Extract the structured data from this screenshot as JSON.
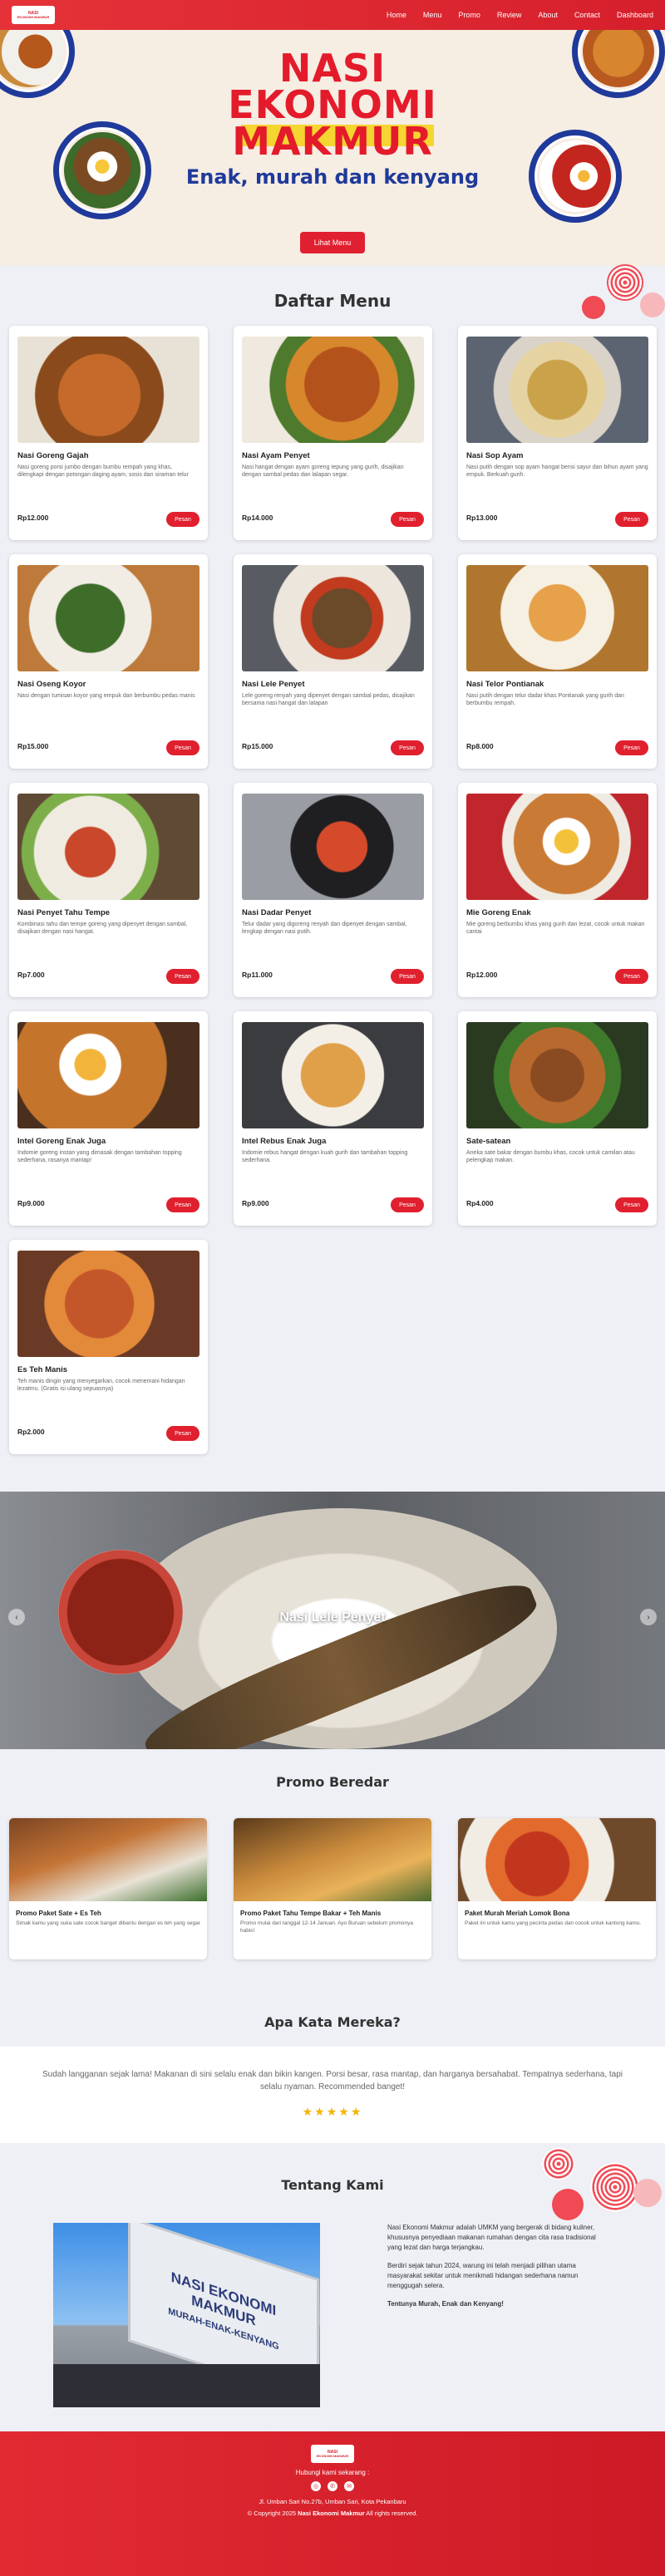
{
  "brand": {
    "logo_line1": "NASI",
    "logo_line2": "EKONOMI MAKMUR"
  },
  "nav": {
    "items": [
      "Home",
      "Menu",
      "Promo",
      "Review",
      "About",
      "Contact",
      "Dashboard"
    ]
  },
  "hero": {
    "title1": "NASI",
    "title2": "EKONOMI",
    "title3": "MAKMUR",
    "subtitle": "Enak, murah dan kenyang",
    "button": "Lihat Menu"
  },
  "menu_section": {
    "title": "Daftar Menu",
    "order_label": "Pesan"
  },
  "menu": [
    {
      "name": "Nasi Goreng Gajah",
      "desc": "Nasi goreng porsi jumbo dengan bumbu rempah yang khas, dilengkapi dengan potongan daging ayam, sosis dan siraman telur",
      "price": "Rp12.000"
    },
    {
      "name": "Nasi Ayam Penyet",
      "desc": "Nasi hangat dengan ayam goreng tepung yang gurih, disajikan dengan sambal pedas dan lalapan segar.",
      "price": "Rp14.000"
    },
    {
      "name": "Nasi Sop Ayam",
      "desc": "Nasi putih dengan sop ayam hangat berisi sayur dan bihun ayam yang empuk. Berkuah gurih.",
      "price": "Rp13.000"
    },
    {
      "name": "Nasi Oseng Koyor",
      "desc": "Nasi dengan tumisan koyor yang empuk dan berbumbu pedas manis",
      "price": "Rp15.000"
    },
    {
      "name": "Nasi Lele Penyet",
      "desc": "Lele goreng renyah yang dipenyet dengan sambal pedas, disajikan bersama nasi hangat dan lalapan",
      "price": "Rp15.000"
    },
    {
      "name": "Nasi Telor Pontianak",
      "desc": "Nasi putih dengan telur dadar khas Pontianak yang gurih dan berbumbu rempah.",
      "price": "Rp8.000"
    },
    {
      "name": "Nasi Penyet Tahu Tempe",
      "desc": "Kombinasi tahu dan tempe goreng yang dipenyet dengan sambal, disajikan dengan nasi hangat.",
      "price": "Rp7.000"
    },
    {
      "name": "Nasi Dadar Penyet",
      "desc": "Telur dadar yang digoreng renyah dan dipenyet dengan sambal, lengkap dengan nasi putih.",
      "price": "Rp11.000"
    },
    {
      "name": "Mie Goreng Enak",
      "desc": "Mie goreng berbumbu khas yang gurih dan lezat, cocok untuk makan cantai",
      "price": "Rp12.000"
    },
    {
      "name": "Intel Goreng Enak Juga",
      "desc": "Indomie goreng instan yang dimasak dengan tambahan topping sederhana, rasanya mantap!",
      "price": "Rp9.000"
    },
    {
      "name": "Intel Rebus Enak Juga",
      "desc": "Indomie rebus hangat dengan kuah gurih dan tambahan topping sederhana.",
      "price": "Rp9.000"
    },
    {
      "name": "Sate-satean",
      "desc": "Aneka sate bakar dengan bumbu khas, cocok untuk camilan atau pelengkap makan.",
      "price": "Rp4.000"
    },
    {
      "name": "Es Teh Manis",
      "desc": "Teh manis dingin yang menyegarkan, cocok menemani hidangan lezatmu. (Gratis isi ulang sepuasnya)",
      "price": "Rp2.000"
    }
  ],
  "slider": {
    "caption": "Nasi Lele Penyet",
    "prev": "‹",
    "next": "›"
  },
  "promo_section": {
    "title": "Promo Beredar"
  },
  "promos": [
    {
      "title": "Promo Paket Sate + Es Teh",
      "desc": "Simak kamu yang suka sate cocok banget dibantu dengan es teh yang segar"
    },
    {
      "title": "Promo Paket Tahu Tempe Bakar + Teh Manis",
      "desc": "Promo mulai dari tanggal 12-14 Januari. Ayo Buruan sebelum promonya habis!"
    },
    {
      "title": "Paket Murah Meriah Lomok Bona",
      "desc": "Paket ini untuk kamu yang pecinta pedas dan cocok untuk kantong kamu."
    }
  ],
  "testimonial": {
    "title": "Apa Kata Mereka?",
    "text": "Sudah langganan sejak lama! Makanan di sini selalu enak dan bikin kangen. Porsi besar, rasa mantap, dan harganya bersahabat. Tempatnya sederhana, tapi selalu nyaman. Recommended banget!",
    "stars": "★★★★★"
  },
  "about": {
    "title": "Tentang Kami",
    "p1": "Nasi Ekonomi Makmur adalah UMKM yang bergerak di bidang kuliner, khususnya penyediaan makanan rumahan dengan cita rasa tradisional yang lezat dan harga terjangkau.",
    "p2": "Berdiri sejak tahun 2024, warung ini telah menjadi pilihan utama masyarakat sekitar untuk menikmati hidangan sederhana namun menggugah selera.",
    "p3": "Tentunya Murah, Enak dan Kenyang!",
    "sign_line1": "NASI EKONOMI",
    "sign_line2": "MAKMUR",
    "sign_line3": "MURAH-ENAK-KENYANG"
  },
  "footer": {
    "contact_label": "Hubungi kami sekarang :",
    "address": "Jl. Umban Sari No.27b, Umban Sari, Kota Pekanbaru",
    "copyright_prefix": "© Copyright 2025",
    "copyright_brand": "Nasi Ekonomi Makmur",
    "copyright_suffix": "All rights reserved."
  },
  "colors": {
    "primary": "#e31b2b",
    "accent_blue": "#1f3a9a",
    "gold": "#f5b400"
  }
}
